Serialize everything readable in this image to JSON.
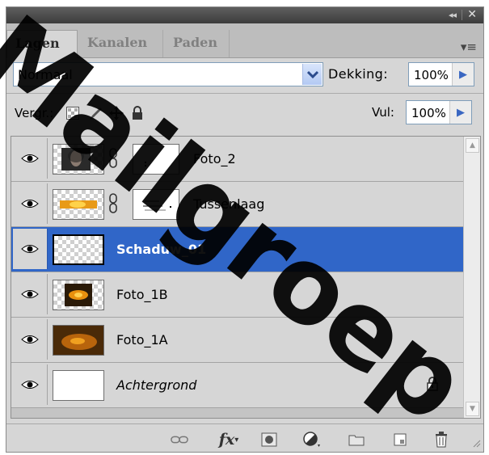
{
  "window": {
    "collapse_glyph": "◂◂",
    "close_glyph": "✕",
    "panel_menu_glyph": "▾≡"
  },
  "tabs": [
    {
      "label": "Lagen",
      "active": true
    },
    {
      "label": "Kanalen",
      "active": false
    },
    {
      "label": "Paden",
      "active": false
    }
  ],
  "blend_mode": {
    "value": "Normaal"
  },
  "opacity": {
    "label": "Dekking:",
    "value": "100%"
  },
  "lock": {
    "label": "Vergr.:",
    "icons": [
      "lock-transparent-icon",
      "lock-brush-icon",
      "lock-move-icon",
      "lock-all-icon"
    ]
  },
  "fill": {
    "label": "Vul:",
    "value": "100%"
  },
  "layers": [
    {
      "name": "Foto_2",
      "italic": false,
      "selected": false,
      "has_mask": true,
      "thumb": "portrait"
    },
    {
      "name": "Tussenlaag",
      "italic": false,
      "selected": false,
      "has_mask": true,
      "thumb": "orange-strip"
    },
    {
      "name": "Schaduw_01",
      "italic": false,
      "selected": true,
      "has_mask": false,
      "thumb": "transparent"
    },
    {
      "name": "Foto_1B",
      "italic": false,
      "selected": false,
      "has_mask": false,
      "thumb": "orange-glow"
    },
    {
      "name": "Foto_1A",
      "italic": false,
      "selected": false,
      "has_mask": false,
      "thumb": "orange-photo"
    },
    {
      "name": "Achtergrond",
      "italic": true,
      "selected": false,
      "has_mask": false,
      "thumb": "white",
      "locked": true
    }
  ],
  "bottom_icons": [
    "link-layers-icon",
    "fx-icon",
    "add-mask-icon",
    "adjustment-layer-icon",
    "new-group-icon",
    "new-layer-icon",
    "delete-layer-icon"
  ],
  "fx_text": "fx",
  "watermark": {
    "text": "Mailgroep",
    "color": "#000000"
  },
  "colors": {
    "selection": "#3066c8",
    "arrow_blue": "#3a67c2"
  }
}
